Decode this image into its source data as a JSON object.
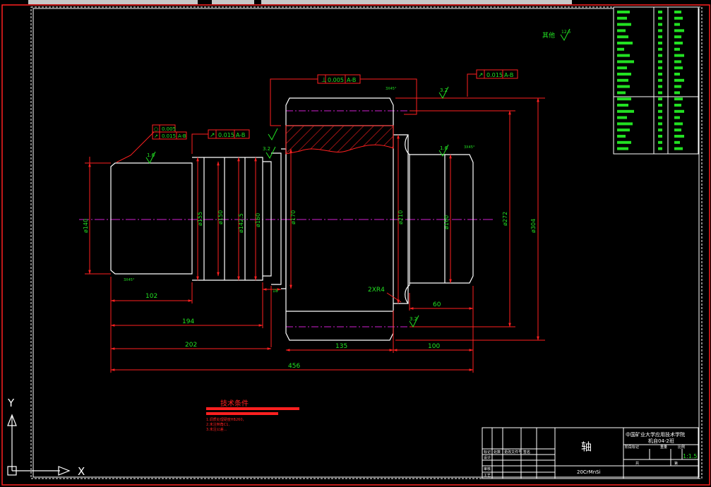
{
  "drawing": {
    "part_name": "轴",
    "material": "20CrMnSi",
    "school": "中国矿业大学应用技术学院",
    "class_name": "机自04-2班",
    "scale": "1:1.5",
    "tech_title": "技术条件",
    "tech_notes": [
      "1.调质处理硬度HB260，",
      "2.未注倒角C1,",
      "3.未注公差..."
    ],
    "roughness_other": "其他",
    "roughness_other_val": "12.5"
  },
  "dimensions": {
    "len_102": "102",
    "len_194": "194",
    "len_202": "202",
    "len_456": "456",
    "len_135": "135",
    "len_100": "100",
    "len_60": "60",
    "len_18": "18",
    "radius": "2XR4",
    "dia_140": "ø140",
    "dia_155": "ø155",
    "dia_150": "ø150",
    "dia_142": "ø142.5",
    "dia_160a": "ø160",
    "dia_170": "ø170",
    "dia_210": "ø210",
    "dia_160b": "ø160",
    "dia_272": "ø272",
    "dia_304": "ø304"
  },
  "tolerances": {
    "perp": "⊥",
    "perp_val": "0.005",
    "perp_ref": "A-B",
    "runout1_val": "0.015",
    "runout1_ref": "A-B",
    "runout2_val": "0.015",
    "runout2_ref": "A-B",
    "left_a": "0.005",
    "left_b": "0.015",
    "left_b_ref": "A-B"
  },
  "roughness": {
    "r1": "1.6",
    "r2": "3.2",
    "r3": "1.6",
    "r4": "3.2",
    "r5": "3.2",
    "chamfer": "3X45°"
  },
  "title_block": {
    "rows": [
      "标记",
      "处数",
      "分区",
      "更改文件号",
      "签名",
      "年月日"
    ],
    "roles": [
      "设计",
      "审核",
      "工艺"
    ],
    "labels": [
      "阶段标记",
      "重量",
      "比例"
    ],
    "sheet": [
      "共",
      "张",
      "第",
      "张"
    ]
  },
  "axes": {
    "y_label": "Y",
    "x_label": "X"
  },
  "colors": {
    "geometry": "#ffffff",
    "dims": "#ff2020",
    "centerline": "#d020d0",
    "text_dim": "#22e022",
    "frame": "#ffffff"
  }
}
